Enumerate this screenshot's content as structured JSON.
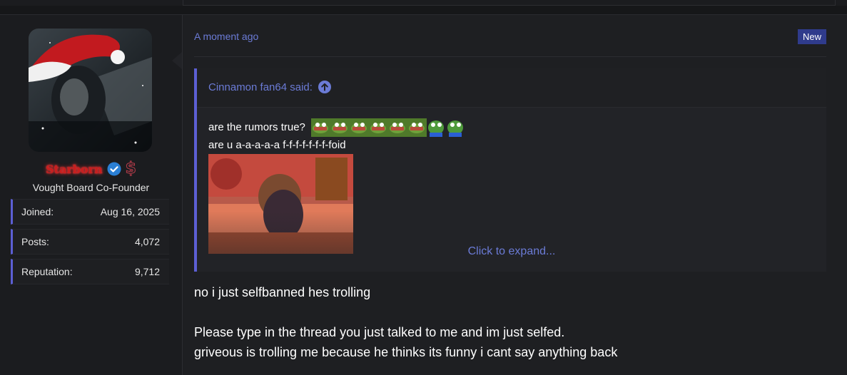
{
  "post": {
    "author": {
      "username": "Starborn",
      "title": "Vought Board Co-Founder",
      "stats": [
        {
          "label": "Joined:",
          "value": "Aug 16, 2025"
        },
        {
          "label": "Posts:",
          "value": "4,072"
        },
        {
          "label": "Reputation:",
          "value": "9,712"
        }
      ]
    },
    "timestamp": "A moment ago",
    "new_badge": "New",
    "quote": {
      "author": "Cinnamon fan64 said:",
      "line1": "are the rumors true?",
      "line2": "are u a-a-a-a-a f-f-f-f-f-f-f-foid",
      "expand": "Click to expand..."
    },
    "message": {
      "line1": "no i just selfbanned hes trolling",
      "line2": "Please type in the thread you just talked to me and im just selfed.",
      "line3": "griveous is trolling me because he thinks its funny i cant say anything back"
    }
  },
  "colors": {
    "accent": "#5c5fd4",
    "link": "#6b7bd6",
    "username": "#c81e1e",
    "new_badge": "#2f3b8c"
  },
  "icons": [
    "verified-check-icon",
    "dollar-badge-icon",
    "arrow-up-circle-icon",
    "pepe-emoji-icon"
  ]
}
